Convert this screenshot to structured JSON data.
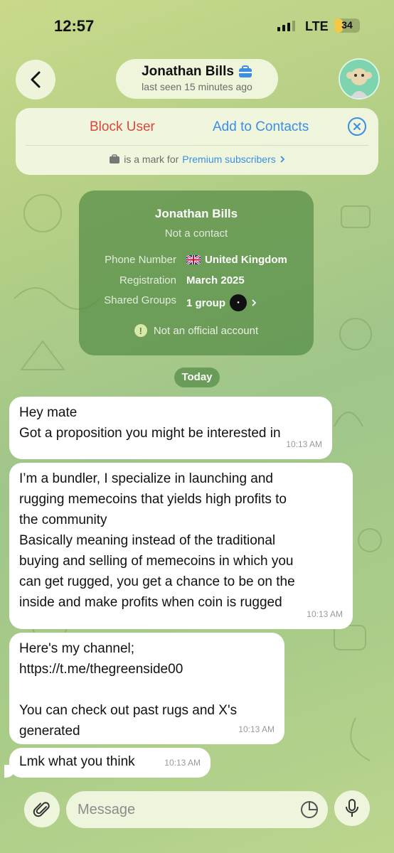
{
  "status_bar": {
    "time": "12:57",
    "network": "LTE",
    "battery": "34",
    "battery_level": 0.34
  },
  "header": {
    "name": "Jonathan Bills",
    "last_seen": "last seen 15 minutes ago",
    "badge_icon": "premium-briefcase-icon",
    "accent_color": "#3a8ee6"
  },
  "banner": {
    "block_label": "Block User",
    "add_label": "Add to Contacts",
    "premium_text": "is a mark for",
    "premium_link": "Premium subscribers",
    "block_color": "#d9483b"
  },
  "info_card": {
    "name": "Jonathan Bills",
    "contact_status": "Not a contact",
    "rows": [
      {
        "label": "Phone Number",
        "value": "United Kingdom"
      },
      {
        "label": "Registration",
        "value": "March 2025"
      },
      {
        "label": "Shared Groups",
        "value": "1 group"
      }
    ],
    "warning": "Not an official account"
  },
  "date_separator": "Today",
  "messages": [
    {
      "text": "Hey mate\nGot a proposition you might be interested in",
      "time": "10:13 AM"
    },
    {
      "text": "I’m a bundler, I specialize in launching and\nrugging memecoins that yields high profits to\nthe community\nBasically meaning instead of the traditional\nbuying and selling of memecoins in which you\ncan get rugged, you get a chance to be on the\ninside and make profits when coin is rugged",
      "time": "10:13 AM"
    },
    {
      "text": "Here's my channel;\nhttps://t.me/thegreenside00\n\nYou can check out past rugs and X's\ngenerated",
      "time": "10:13 AM"
    },
    {
      "text": "Lmk what you think",
      "time": "10:13 AM"
    }
  ],
  "input": {
    "placeholder": "Message"
  }
}
